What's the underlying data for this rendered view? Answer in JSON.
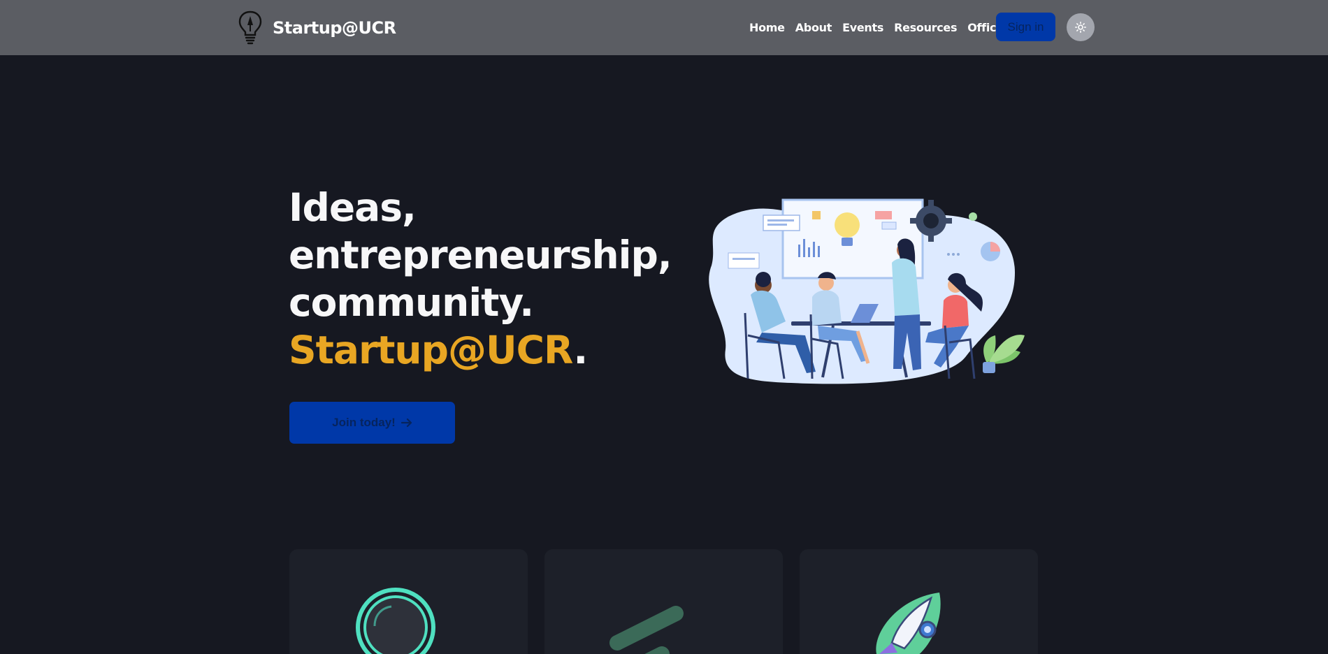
{
  "nav": {
    "brand": "Startup@UCR",
    "links": [
      "Home",
      "About",
      "Events",
      "Resources",
      "Officers"
    ],
    "signin_label": "Sign in",
    "theme_icon": "sun-icon"
  },
  "hero": {
    "title_lines": [
      "Ideas,",
      "entrepreneurship,",
      "community."
    ],
    "brand_accent": "Startup@UCR",
    "brand_suffix": ".",
    "cta_label": "Join today!",
    "cta_icon": "arrow-right-icon",
    "illustration": "team-meeting-illustration"
  },
  "features": {
    "icons": [
      "ring-icon",
      "stripes-icon",
      "rocket-icon"
    ]
  },
  "colors": {
    "nav_bg": "#5b5d63",
    "page_bg": "#161821",
    "card_bg": "#1d2029",
    "accent": "#e8a623",
    "primary": "#0038a8"
  }
}
